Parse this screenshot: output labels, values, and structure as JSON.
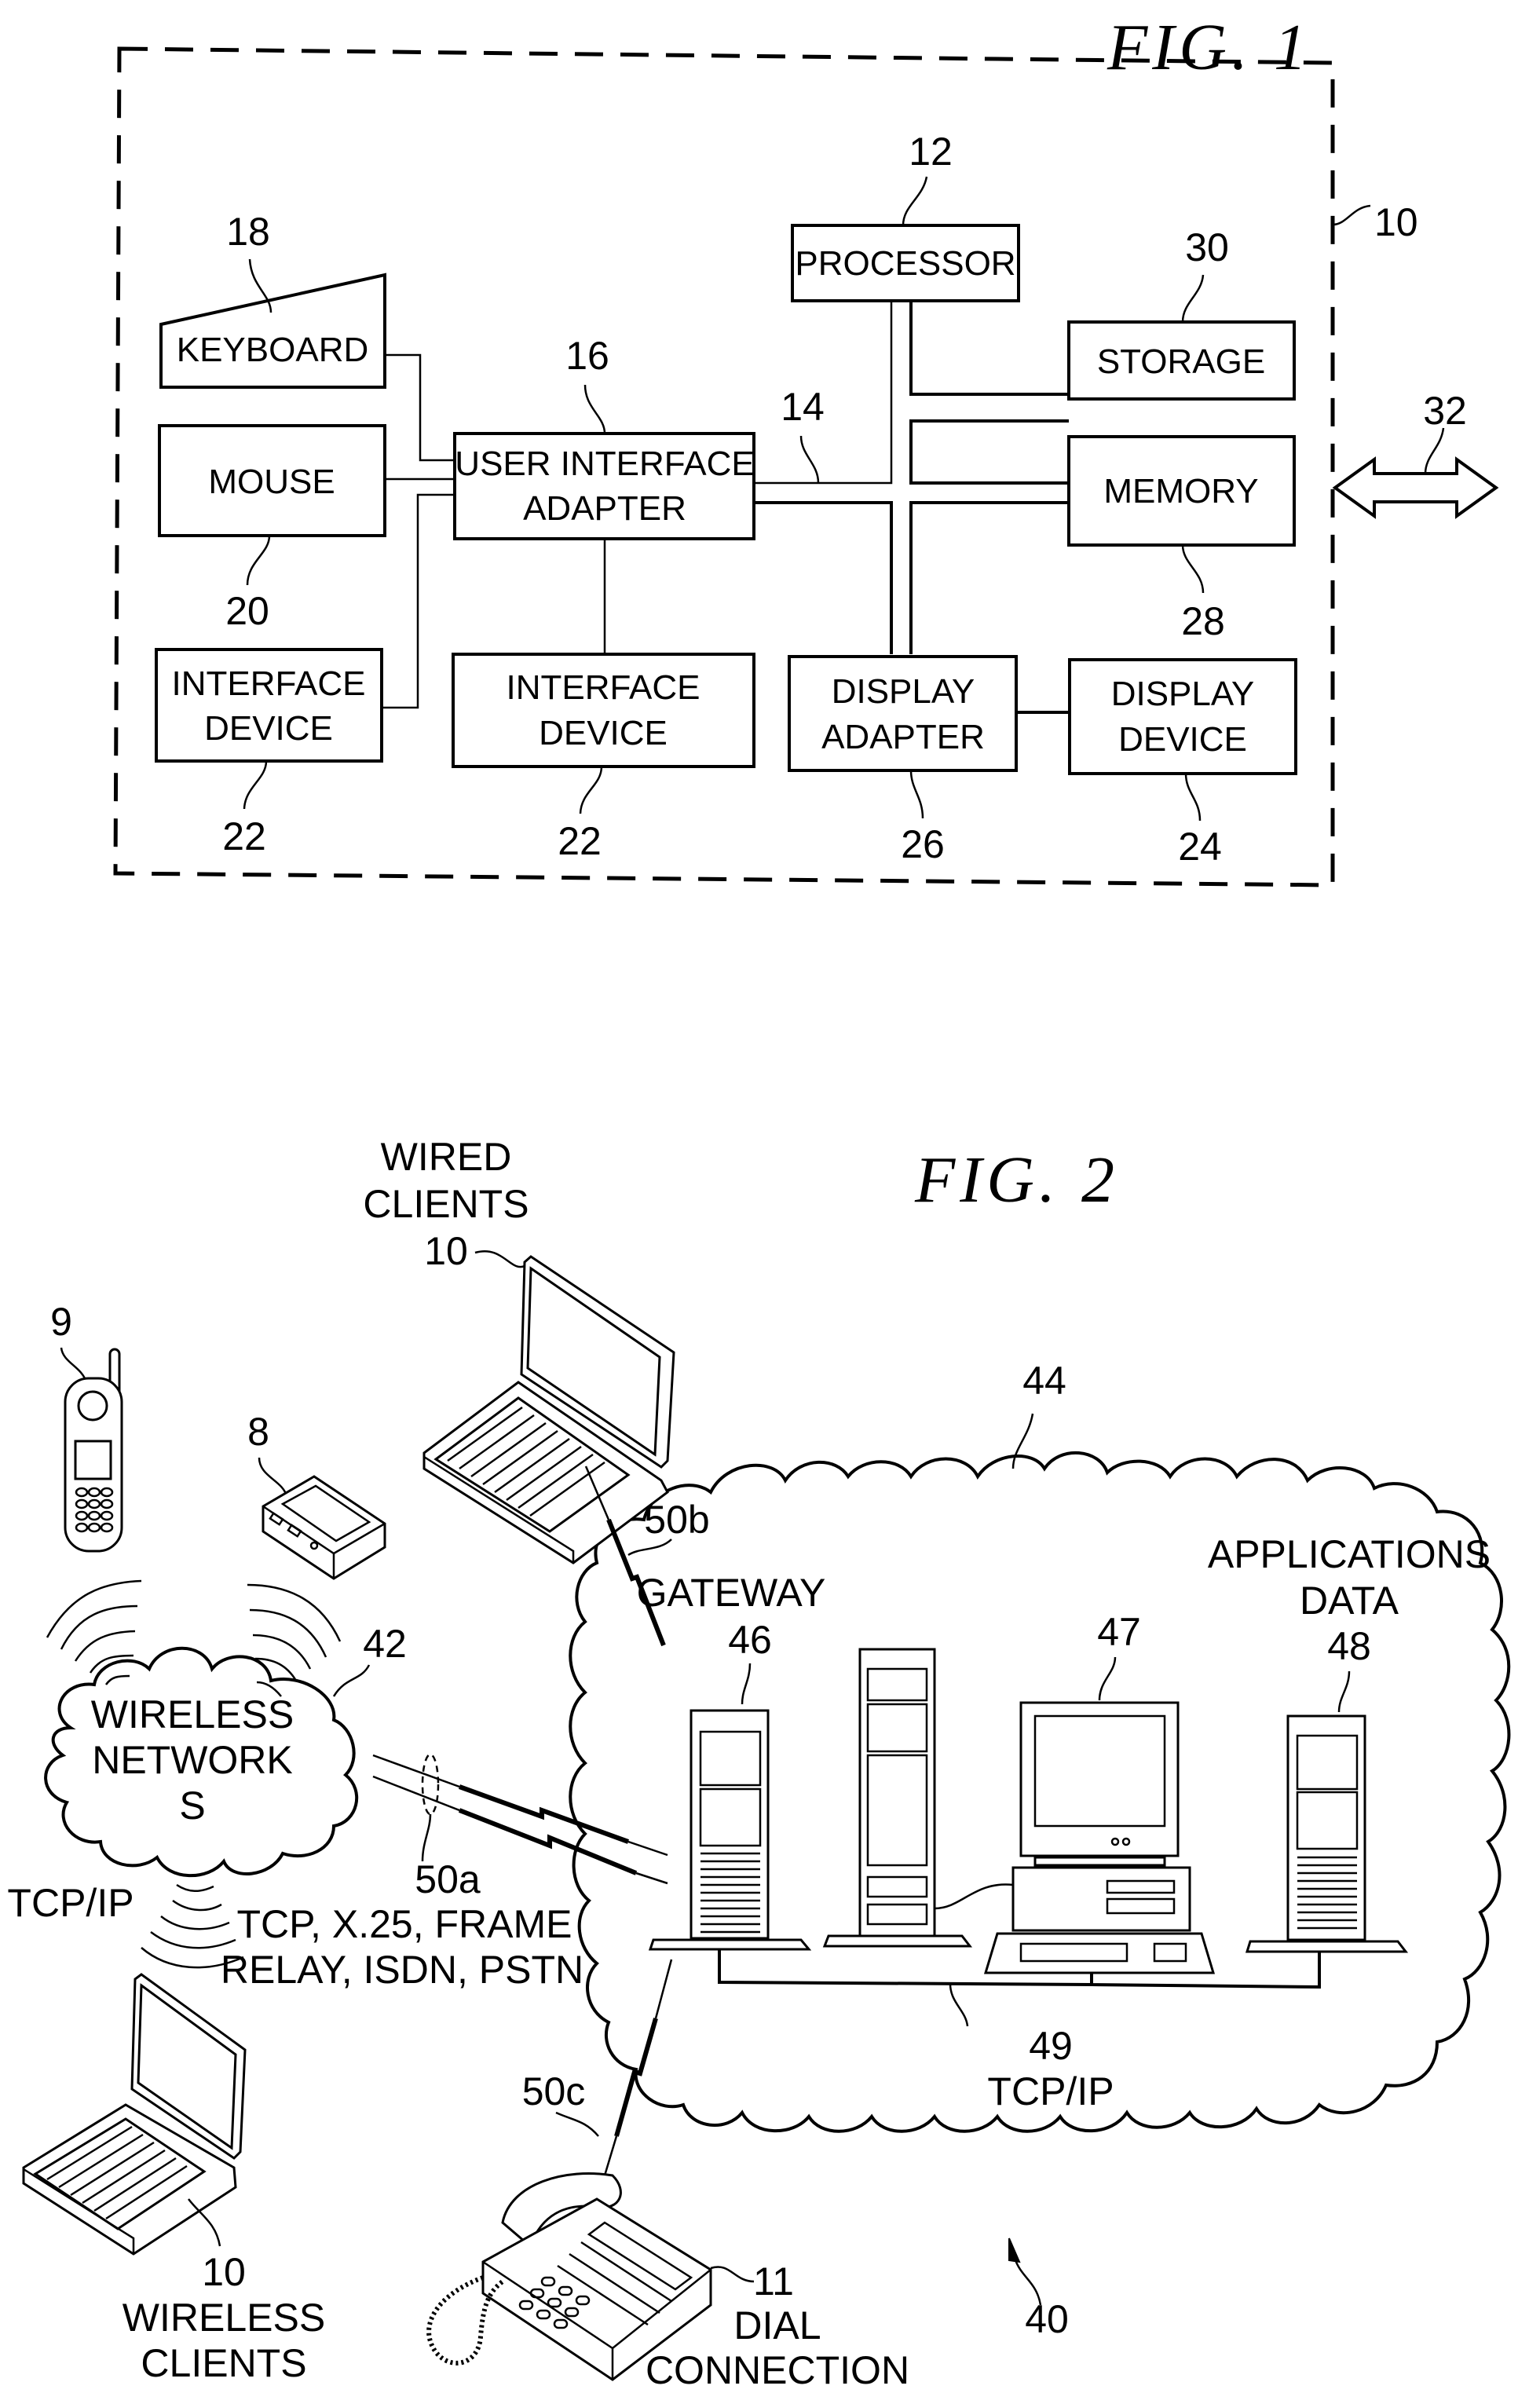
{
  "fig1": {
    "title": "FIG. 1",
    "system_ref": "10",
    "bus_ref": "14",
    "network_link_ref": "32",
    "blocks": {
      "keyboard": {
        "label": "KEYBOARD",
        "ref": "18"
      },
      "mouse": {
        "label": "MOUSE",
        "ref": "20"
      },
      "interface_device_left": {
        "label_line1": "INTERFACE",
        "label_line2": "DEVICE",
        "ref": "22"
      },
      "user_interface_adapter": {
        "label_line1": "USER  INTERFACE",
        "label_line2": "ADAPTER",
        "ref": "16"
      },
      "interface_device_mid": {
        "label_line1": "INTERFACE",
        "label_line2": "DEVICE",
        "ref": "22"
      },
      "processor": {
        "label": "PROCESSOR",
        "ref": "12"
      },
      "storage": {
        "label": "STORAGE",
        "ref": "30"
      },
      "memory": {
        "label": "MEMORY",
        "ref": "28"
      },
      "display_adapter": {
        "label_line1": "DISPLAY",
        "label_line2": "ADAPTER",
        "ref": "26"
      },
      "display_device": {
        "label_line1": "DISPLAY",
        "label_line2": "DEVICE",
        "ref": "24"
      }
    }
  },
  "fig2": {
    "title": "FIG. 2",
    "system_ref": "40",
    "wired_clients": {
      "label_line1": "WIRED",
      "label_line2": "CLIENTS",
      "ref": "10"
    },
    "cell_phone": {
      "ref": "9"
    },
    "pda": {
      "ref": "8"
    },
    "wireless_network": {
      "label_line1": "WIRELESS",
      "label_line2": "NETWORK",
      "label_line3": "S",
      "ref": "42"
    },
    "wireless_protocol": "TCP/IP",
    "link_50a": {
      "ref": "50a",
      "protocols_line1": "TCP,  X.25,  FRAME",
      "protocols_line2": "RELAY,  ISDN,  PSTN"
    },
    "link_50b": {
      "ref": "50b"
    },
    "link_50c": {
      "ref": "50c"
    },
    "server_network": {
      "ref": "44"
    },
    "gateway": {
      "label": "GATEWAY",
      "ref": "46"
    },
    "workstation": {
      "ref": "47"
    },
    "applications_data": {
      "label_line1": "APPLICATIONS",
      "label_line2": "DATA",
      "ref": "48"
    },
    "lan": {
      "ref": "49",
      "protocol": "TCP/IP"
    },
    "wireless_clients": {
      "label_line1": "WIRELESS",
      "label_line2": "CLIENTS",
      "ref": "10"
    },
    "dial_connection": {
      "label_line1": "DIAL",
      "label_line2": "CONNECTION",
      "ref": "11"
    }
  }
}
